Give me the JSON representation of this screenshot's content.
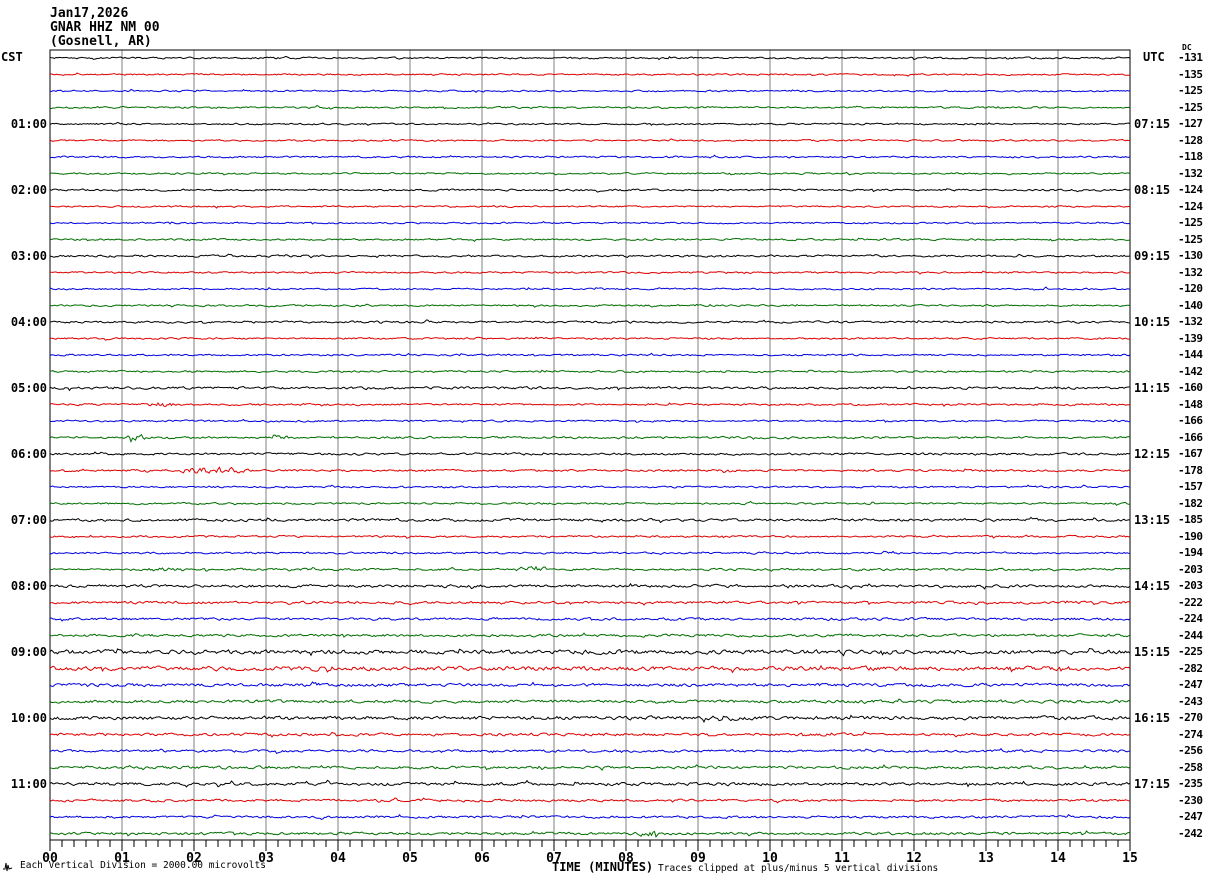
{
  "title": {
    "date": "Jan17,2026",
    "station": "GNAR HHZ NM 00",
    "location": "(Gosnell, AR)"
  },
  "left_axis": {
    "header": "CST",
    "labels": [
      {
        "row": 4,
        "text": "01:00"
      },
      {
        "row": 8,
        "text": "02:00"
      },
      {
        "row": 12,
        "text": "03:00"
      },
      {
        "row": 16,
        "text": "04:00"
      },
      {
        "row": 20,
        "text": "05:00"
      },
      {
        "row": 24,
        "text": "06:00"
      },
      {
        "row": 28,
        "text": "07:00"
      },
      {
        "row": 32,
        "text": "08:00"
      },
      {
        "row": 36,
        "text": "09:00"
      },
      {
        "row": 40,
        "text": "10:00"
      },
      {
        "row": 44,
        "text": "11:00"
      }
    ]
  },
  "right_axis": {
    "header": "UTC",
    "dc_header": "DC",
    "labels": [
      {
        "row": 4,
        "text": "07:15"
      },
      {
        "row": 8,
        "text": "08:15"
      },
      {
        "row": 12,
        "text": "09:15"
      },
      {
        "row": 16,
        "text": "10:15"
      },
      {
        "row": 20,
        "text": "11:15"
      },
      {
        "row": 24,
        "text": "12:15"
      },
      {
        "row": 28,
        "text": "13:15"
      },
      {
        "row": 32,
        "text": "14:15"
      },
      {
        "row": 36,
        "text": "15:15"
      },
      {
        "row": 40,
        "text": "16:15"
      },
      {
        "row": 44,
        "text": "17:15"
      }
    ]
  },
  "dc_values": [
    "-131",
    "-135",
    "-125",
    "-125",
    "-127",
    "-128",
    "-118",
    "-132",
    "-124",
    "-124",
    "-125",
    "-125",
    "-130",
    "-132",
    "-120",
    "-140",
    "-132",
    "-139",
    "-144",
    "-142",
    "-160",
    "-148",
    "-166",
    "-166",
    "-167",
    "-178",
    "-157",
    "-182",
    "-185",
    "-190",
    "-194",
    "-203",
    "-203",
    "-222",
    "-224",
    "-244",
    "-225",
    "-282",
    "-247",
    "-243",
    "-270",
    "-274",
    "-256",
    "-258",
    "-235",
    "-230",
    "-247",
    "-242"
  ],
  "x_axis": {
    "label": "TIME (MINUTES)",
    "ticks": [
      "00",
      "01",
      "02",
      "03",
      "04",
      "05",
      "06",
      "07",
      "08",
      "09",
      "10",
      "11",
      "12",
      "13",
      "14",
      "15"
    ]
  },
  "footer": {
    "scale_note": "Each Vertical Division = 2000.00 microvolts",
    "clip_note": "Traces clipped at plus/minus 5 vertical divisions"
  },
  "palette": {
    "trace_cycle": [
      "#000000",
      "#dd0000",
      "#0000dd",
      "#006e00"
    ],
    "grid": "#808080",
    "frame": "#000000",
    "background": "#ffffff"
  },
  "rows": [
    {
      "color_index": 0,
      "amp": 1.3,
      "bursts": []
    },
    {
      "color_index": 1,
      "amp": 1.2,
      "bursts": []
    },
    {
      "color_index": 2,
      "amp": 1.2,
      "bursts": []
    },
    {
      "color_index": 3,
      "amp": 1.3,
      "bursts": []
    },
    {
      "color_index": 0,
      "amp": 1.2,
      "bursts": []
    },
    {
      "color_index": 1,
      "amp": 1.2,
      "bursts": []
    },
    {
      "color_index": 2,
      "amp": 1.3,
      "bursts": []
    },
    {
      "color_index": 3,
      "amp": 1.2,
      "bursts": []
    },
    {
      "color_index": 0,
      "amp": 1.4,
      "bursts": []
    },
    {
      "color_index": 1,
      "amp": 1.2,
      "bursts": []
    },
    {
      "color_index": 2,
      "amp": 1.2,
      "bursts": []
    },
    {
      "color_index": 3,
      "amp": 1.3,
      "bursts": []
    },
    {
      "color_index": 0,
      "amp": 1.5,
      "bursts": []
    },
    {
      "color_index": 1,
      "amp": 1.3,
      "bursts": []
    },
    {
      "color_index": 2,
      "amp": 1.2,
      "bursts": []
    },
    {
      "color_index": 3,
      "amp": 1.3,
      "bursts": []
    },
    {
      "color_index": 0,
      "amp": 1.5,
      "bursts": []
    },
    {
      "color_index": 1,
      "amp": 1.3,
      "bursts": []
    },
    {
      "color_index": 2,
      "amp": 1.3,
      "bursts": []
    },
    {
      "color_index": 3,
      "amp": 1.4,
      "bursts": []
    },
    {
      "color_index": 0,
      "amp": 1.8,
      "bursts": []
    },
    {
      "color_index": 1,
      "amp": 1.4,
      "bursts": [
        {
          "t0": 1.3,
          "t1": 1.8,
          "a": 3.5
        }
      ]
    },
    {
      "color_index": 2,
      "amp": 1.3,
      "bursts": []
    },
    {
      "color_index": 3,
      "amp": 1.5,
      "bursts": [
        {
          "t0": 1.0,
          "t1": 1.4,
          "a": 4
        },
        {
          "t0": 2.95,
          "t1": 3.4,
          "a": 3
        }
      ]
    },
    {
      "color_index": 0,
      "amp": 1.6,
      "bursts": []
    },
    {
      "color_index": 1,
      "amp": 1.5,
      "bursts": [
        {
          "t0": 1.32,
          "t1": 1.42,
          "a": 7
        },
        {
          "t0": 1.6,
          "t1": 2.9,
          "a": 4.5
        }
      ]
    },
    {
      "color_index": 2,
      "amp": 1.3,
      "bursts": []
    },
    {
      "color_index": 3,
      "amp": 1.4,
      "bursts": []
    },
    {
      "color_index": 0,
      "amp": 1.9,
      "bursts": []
    },
    {
      "color_index": 1,
      "amp": 1.4,
      "bursts": []
    },
    {
      "color_index": 2,
      "amp": 1.4,
      "bursts": []
    },
    {
      "color_index": 3,
      "amp": 1.6,
      "bursts": [
        {
          "t0": 1.25,
          "t1": 2.0,
          "a": 3
        },
        {
          "t0": 6.4,
          "t1": 7.0,
          "a": 4
        }
      ]
    },
    {
      "color_index": 0,
      "amp": 2.0,
      "bursts": []
    },
    {
      "color_index": 1,
      "amp": 1.8,
      "bursts": []
    },
    {
      "color_index": 2,
      "amp": 1.8,
      "bursts": []
    },
    {
      "color_index": 3,
      "amp": 1.9,
      "bursts": []
    },
    {
      "color_index": 0,
      "amp": 3.0,
      "bursts": []
    },
    {
      "color_index": 1,
      "amp": 3.0,
      "bursts": []
    },
    {
      "color_index": 2,
      "amp": 2.2,
      "bursts": [
        {
          "t0": 3.6,
          "t1": 3.78,
          "a": 5
        }
      ]
    },
    {
      "color_index": 3,
      "amp": 2.2,
      "bursts": []
    },
    {
      "color_index": 0,
      "amp": 2.6,
      "bursts": [
        {
          "t0": 9.1,
          "t1": 9.6,
          "a": 3.5
        }
      ]
    },
    {
      "color_index": 1,
      "amp": 2.0,
      "bursts": []
    },
    {
      "color_index": 2,
      "amp": 1.8,
      "bursts": []
    },
    {
      "color_index": 3,
      "amp": 2.0,
      "bursts": []
    },
    {
      "color_index": 0,
      "amp": 2.2,
      "bursts": []
    },
    {
      "color_index": 1,
      "amp": 1.8,
      "bursts": []
    },
    {
      "color_index": 2,
      "amp": 1.7,
      "bursts": []
    },
    {
      "color_index": 3,
      "amp": 1.9,
      "bursts": [
        {
          "t0": 8.05,
          "t1": 8.55,
          "a": 3.5
        }
      ]
    }
  ],
  "chart_data": {
    "type": "line",
    "subtype": "helicorder-seismogram",
    "title": "Jan17,2026 GNAR HHZ NM 00 (Gosnell, AR)",
    "station": "GNAR HHZ NM 00",
    "station_location": "Gosnell, AR",
    "date": "Jan17,2026",
    "xlabel": "TIME (MINUTES)",
    "x_range_minutes": [
      0,
      15
    ],
    "major_tick_minutes": 1,
    "minor_tick_seconds": 10,
    "rows_per_hour": 4,
    "row_duration_minutes": 15,
    "trace_color_cycle": [
      "black",
      "red",
      "blue",
      "green"
    ],
    "left_hour_labels_cst": [
      "01:00",
      "02:00",
      "03:00",
      "04:00",
      "05:00",
      "06:00",
      "07:00",
      "08:00",
      "09:00",
      "10:00",
      "11:00"
    ],
    "right_hour_labels_utc": [
      "07:15",
      "08:15",
      "09:15",
      "10:15",
      "11:15",
      "12:15",
      "13:15",
      "14:15",
      "15:15",
      "16:15",
      "17:15"
    ],
    "dc_offsets_per_trace": [
      -131,
      -135,
      -125,
      -125,
      -127,
      -128,
      -118,
      -132,
      -124,
      -124,
      -125,
      -125,
      -130,
      -132,
      -120,
      -140,
      -132,
      -139,
      -144,
      -142,
      -160,
      -148,
      -166,
      -166,
      -167,
      -178,
      -157,
      -182,
      -185,
      -190,
      -194,
      -203,
      -203,
      -222,
      -224,
      -244,
      -225,
      -282,
      -247,
      -243,
      -270,
      -274,
      -256,
      -258,
      -235,
      -230,
      -247,
      -242
    ],
    "scale": "Each Vertical Division = 2000.00 microvolts",
    "clipping": "Traces clipped at plus/minus 5 vertical divisions",
    "grid": "vertical minute gridlines on"
  }
}
